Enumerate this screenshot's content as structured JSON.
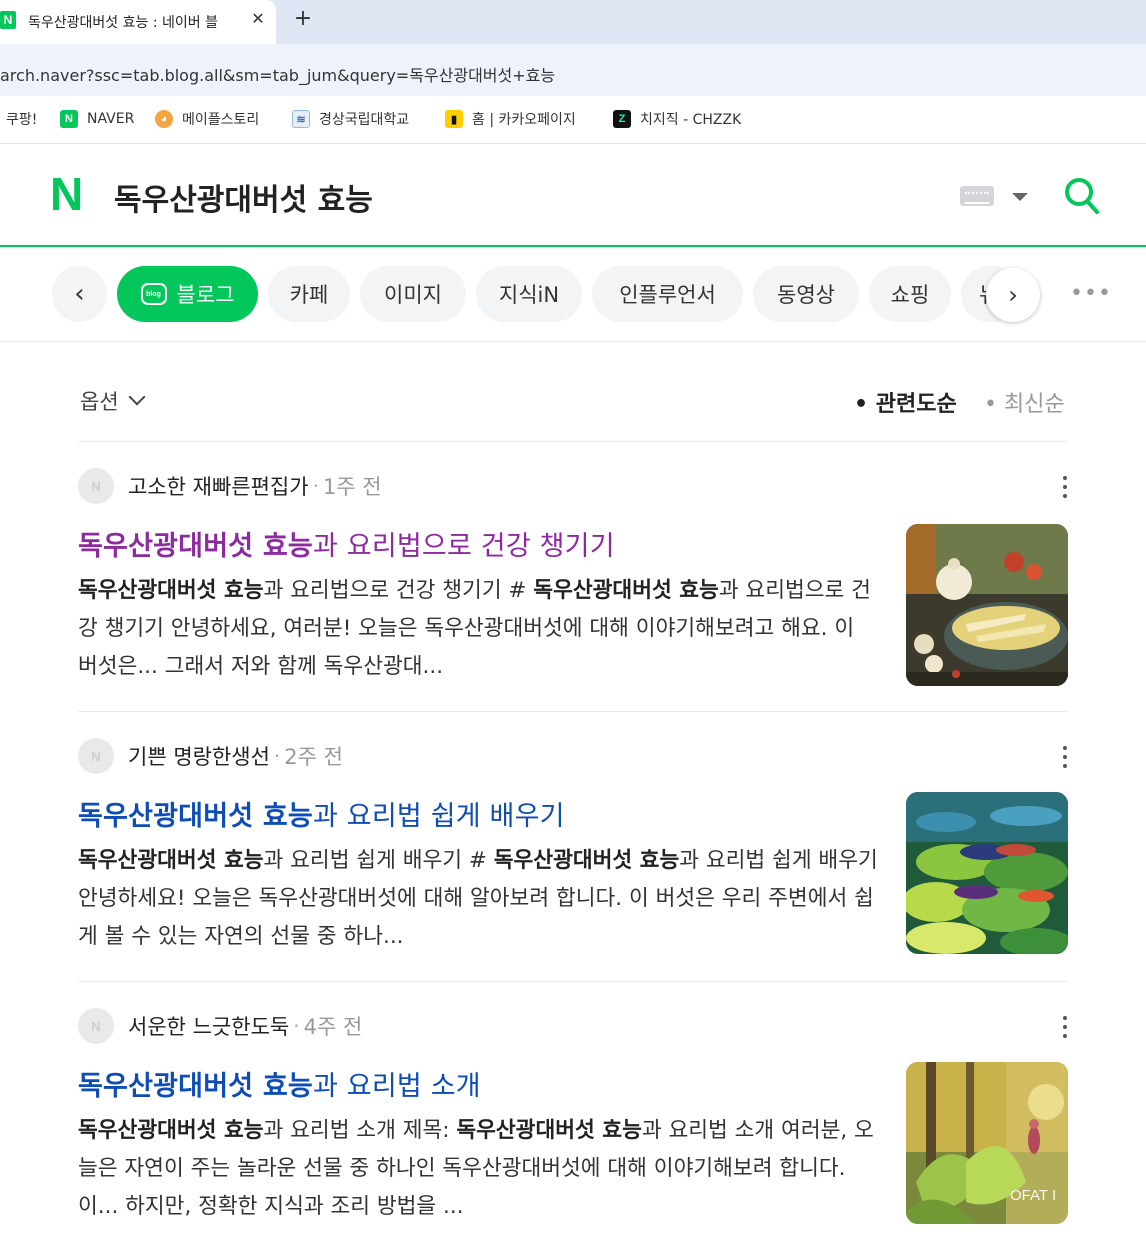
{
  "browser": {
    "tab_title": "독우산광대버섯 효능 : 네이버 블",
    "tab_close": "✕",
    "new_tab": "+",
    "url": "arch.naver?ssc=tab.blog.all&sm=tab_jum&query=독우산광대버섯+효능",
    "bookmarks": [
      {
        "label": "쿠팡!",
        "icon": "coupang-icon"
      },
      {
        "label": "NAVER",
        "icon": "naver-icon"
      },
      {
        "label": "메이플스토리",
        "icon": "maplestory-icon"
      },
      {
        "label": "경상국립대학교",
        "icon": "university-icon"
      },
      {
        "label": "홈 | 카카오페이지",
        "icon": "kakaopage-icon"
      },
      {
        "label": "치지직 - CHZZK",
        "icon": "chzzk-icon"
      }
    ]
  },
  "search": {
    "logo": "N",
    "query": "독우산광대버섯 효능"
  },
  "categories": {
    "prev": "‹",
    "next": "›",
    "more": "•••",
    "items": [
      {
        "label": "블로그",
        "active": true
      },
      {
        "label": "카페"
      },
      {
        "label": "이미지"
      },
      {
        "label": "지식iN"
      },
      {
        "label": "인플루언서"
      },
      {
        "label": "동영상"
      },
      {
        "label": "쇼핑"
      },
      {
        "label": "뉴스"
      }
    ]
  },
  "options": {
    "label": "옵션",
    "sort_relevance": "• 관련도순",
    "sort_latest": "• 최신순"
  },
  "results": [
    {
      "avatar": "N",
      "author": "고소한 재빠른편집가",
      "time": "1주 전",
      "title_highlight": "독우산광대버섯 효능",
      "title_rest": "과 요리법으로 건강 챙기기",
      "visited": true,
      "snippet": {
        "p1_bold": "독우산광대버섯 효능",
        "p2": "과 요리법으로 건강 챙기기 # ",
        "p3_bold": "독우산광대버섯 효능",
        "p4": "과 요리법으로 건강 챙기기 안녕하세요, 여러분! 오늘은 독우산광대버섯에 대해 이야기해보려고 해요. 이 버섯은... 그래서 저와 함께 독우산광대..."
      }
    },
    {
      "avatar": "N",
      "author": "기쁜 명랑한생선",
      "time": "2주 전",
      "title_highlight": "독우산광대버섯 효능",
      "title_rest": "과 요리법 쉽게 배우기",
      "visited": false,
      "snippet": {
        "p1_bold": "독우산광대버섯 효능",
        "p2": "과 요리법 쉽게 배우기 # ",
        "p3_bold": "독우산광대버섯 효능",
        "p4": "과 요리법 쉽게 배우기 안녕하세요! 오늘은 독우산광대버섯에 대해 알아보려 합니다. 이 버섯은 우리 주변에서 쉽게 볼 수 있는 자연의 선물 중 하나..."
      }
    },
    {
      "avatar": "N",
      "author": "서운한 느긋한도둑",
      "time": "4주 전",
      "title_highlight": "독우산광대버섯 효능",
      "title_rest": "과 요리법 소개",
      "visited": false,
      "snippet": {
        "p1_bold": "독우산광대버섯 효능",
        "p2": "과 요리법 소개 제목: ",
        "p3_bold": "독우산광대버섯 효능",
        "p4": "과 요리법 소개 여러분, 오늘은 자연이 주는 놀라운 선물 중 하나인 독우산광대버섯에 대해 이야기해보려 합니다. 이... 하지만, 정확한 지식과 조리 방법을 ..."
      },
      "thumb_text": "OFAT I"
    }
  ],
  "colors": {
    "brand_green": "#03c75a",
    "link_blue": "#0e4db6",
    "visited_purple": "#8d2aa0"
  }
}
